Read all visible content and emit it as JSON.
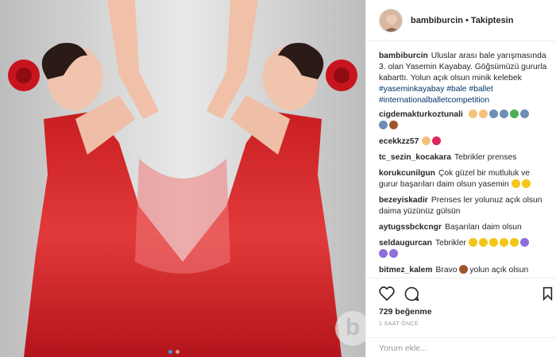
{
  "post": {
    "username": "bambiburcin",
    "follow_status": "Takiptesin",
    "caption": {
      "username": "bambiburcin",
      "text": "Uluslar arası bale yarışmasında 3. olan Yasemin Kayabay. Göğsümüzü gururla kabarttı. Yolun açık olsun minik kelebek",
      "hashtags": [
        "#yaseminkayabay",
        "#bale",
        "#ballet",
        "#internationalballetcompetition"
      ]
    },
    "comments": [
      {
        "username": "cigdemakturkoztunali",
        "text": "",
        "emojis": [
          "#f2c27b",
          "#f2c27b",
          "#6b8fb5",
          "#6b8fb5",
          "#4caf50",
          "#6b8fb5"
        ]
      },
      {
        "username": "",
        "text": "",
        "emojis": [
          "#6b8fb5",
          "#a0522d"
        ]
      },
      {
        "username": "ecekkzz57",
        "text": "",
        "emojis": [
          "#f2c27b",
          "#e0245e"
        ]
      },
      {
        "username": "tc_sezin_kocakara",
        "text": "Tebrikler prenses",
        "emojis": []
      },
      {
        "username": "korukcunilgun",
        "text": "Çok güzel bir mutluluk ve gurur başarıları daim olsun yasemin",
        "emojis": [
          "#f5c518",
          "#f5c518"
        ]
      },
      {
        "username": "bezeyiskadir",
        "text": "Prenses ler yolunuz açık olsun daima yüzünüz gülsün",
        "emojis": []
      },
      {
        "username": "aytugssbckcngr",
        "text": "Başarıları daim olsun",
        "emojis": []
      },
      {
        "username": "seldaugurcan",
        "text": "Tebrikler",
        "emojis": [
          "#f5c518",
          "#f5c518",
          "#f5c518",
          "#f5c518",
          "#f5c518",
          "#8e6fd8",
          "#8e6fd8",
          "#8e6fd8"
        ]
      },
      {
        "username": "bitmez_kalem",
        "text": "Bravo",
        "emojis": [
          "#a0522d"
        ],
        "text_after": "yolun açık olsun"
      }
    ],
    "likes": "729 beğenme",
    "time": "1 SAAT ÖNCE",
    "add_comment_placeholder": "Yorum ekle...",
    "watermark": "b"
  },
  "icons": [
    "heart-icon",
    "comment-icon",
    "bookmark-icon"
  ],
  "colors": {
    "dress": "#d8302e",
    "flower": "#c8141e",
    "link": "#003569",
    "carousel_active": "#3897f0"
  }
}
